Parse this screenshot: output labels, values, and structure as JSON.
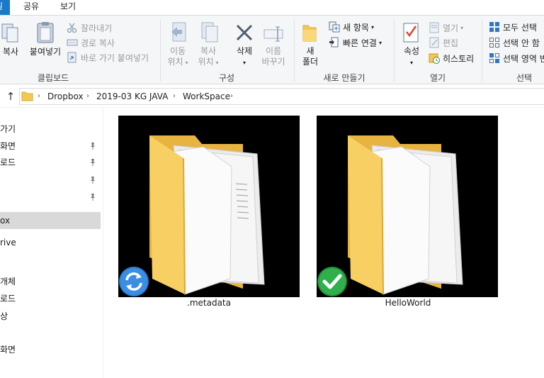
{
  "ribbon_tabs": [
    {
      "label": "파일",
      "active": true
    },
    {
      "label": "공유",
      "active": false
    },
    {
      "label": "보기",
      "active": false
    }
  ],
  "ribbon": {
    "clipboard": {
      "copy_label": "복사",
      "paste_label": "붙여넣기",
      "cut_label": "잘라내기",
      "copy_path_label": "경로 복사",
      "paste_shortcut_label": "바로 가기 붙여넣기",
      "group_label": "클립보드"
    },
    "organize": {
      "move_to_line1": "이동",
      "move_to_line2": "위치",
      "copy_to_line1": "복사",
      "copy_to_line2": "위치",
      "delete_label": "삭제",
      "rename_line1": "이름",
      "rename_line2": "바꾸기",
      "group_label": "구성"
    },
    "new": {
      "new_folder_line1": "새",
      "new_folder_line2": "폴더",
      "new_item_label": "새 항목",
      "easy_access_label": "빠른 연결",
      "group_label": "새로 만들기"
    },
    "open": {
      "properties_label": "속성",
      "open_label": "열기",
      "edit_label": "편집",
      "history_label": "히스토리",
      "group_label": "열기"
    },
    "select": {
      "select_all_label": "모두 선택",
      "select_none_label": "선택 안 함",
      "invert_selection_label": "선택 영역 반",
      "group_label": "선택"
    }
  },
  "address": {
    "crumbs": [
      "Dropbox",
      "2019-03 KG JAVA",
      "WorkSpace"
    ]
  },
  "nav": {
    "items": [
      {
        "label": "가기",
        "pinned": false
      },
      {
        "label": "화면",
        "pinned": true
      },
      {
        "label": "로드",
        "pinned": true
      },
      {
        "label": "",
        "pinned": true
      },
      {
        "label": "",
        "pinned": true
      },
      {
        "label": "ox",
        "pinned": false,
        "selected": true
      },
      {
        "label": "rive",
        "pinned": false
      },
      {
        "label": "개체",
        "pinned": false
      },
      {
        "label": "로드",
        "pinned": false
      },
      {
        "label": "상",
        "pinned": false
      },
      {
        "label": "화면",
        "pinned": false
      }
    ]
  },
  "files": [
    {
      "name": ".metadata",
      "sync_status": "syncing",
      "icon": "folder-icon"
    },
    {
      "name": "HelloWorld",
      "sync_status": "synced",
      "icon": "folder-icon"
    }
  ],
  "colors": {
    "accent": "#1979ca",
    "folder": "#f5c854",
    "sync_blue": "#2a7fd6",
    "sync_green": "#28a745"
  }
}
